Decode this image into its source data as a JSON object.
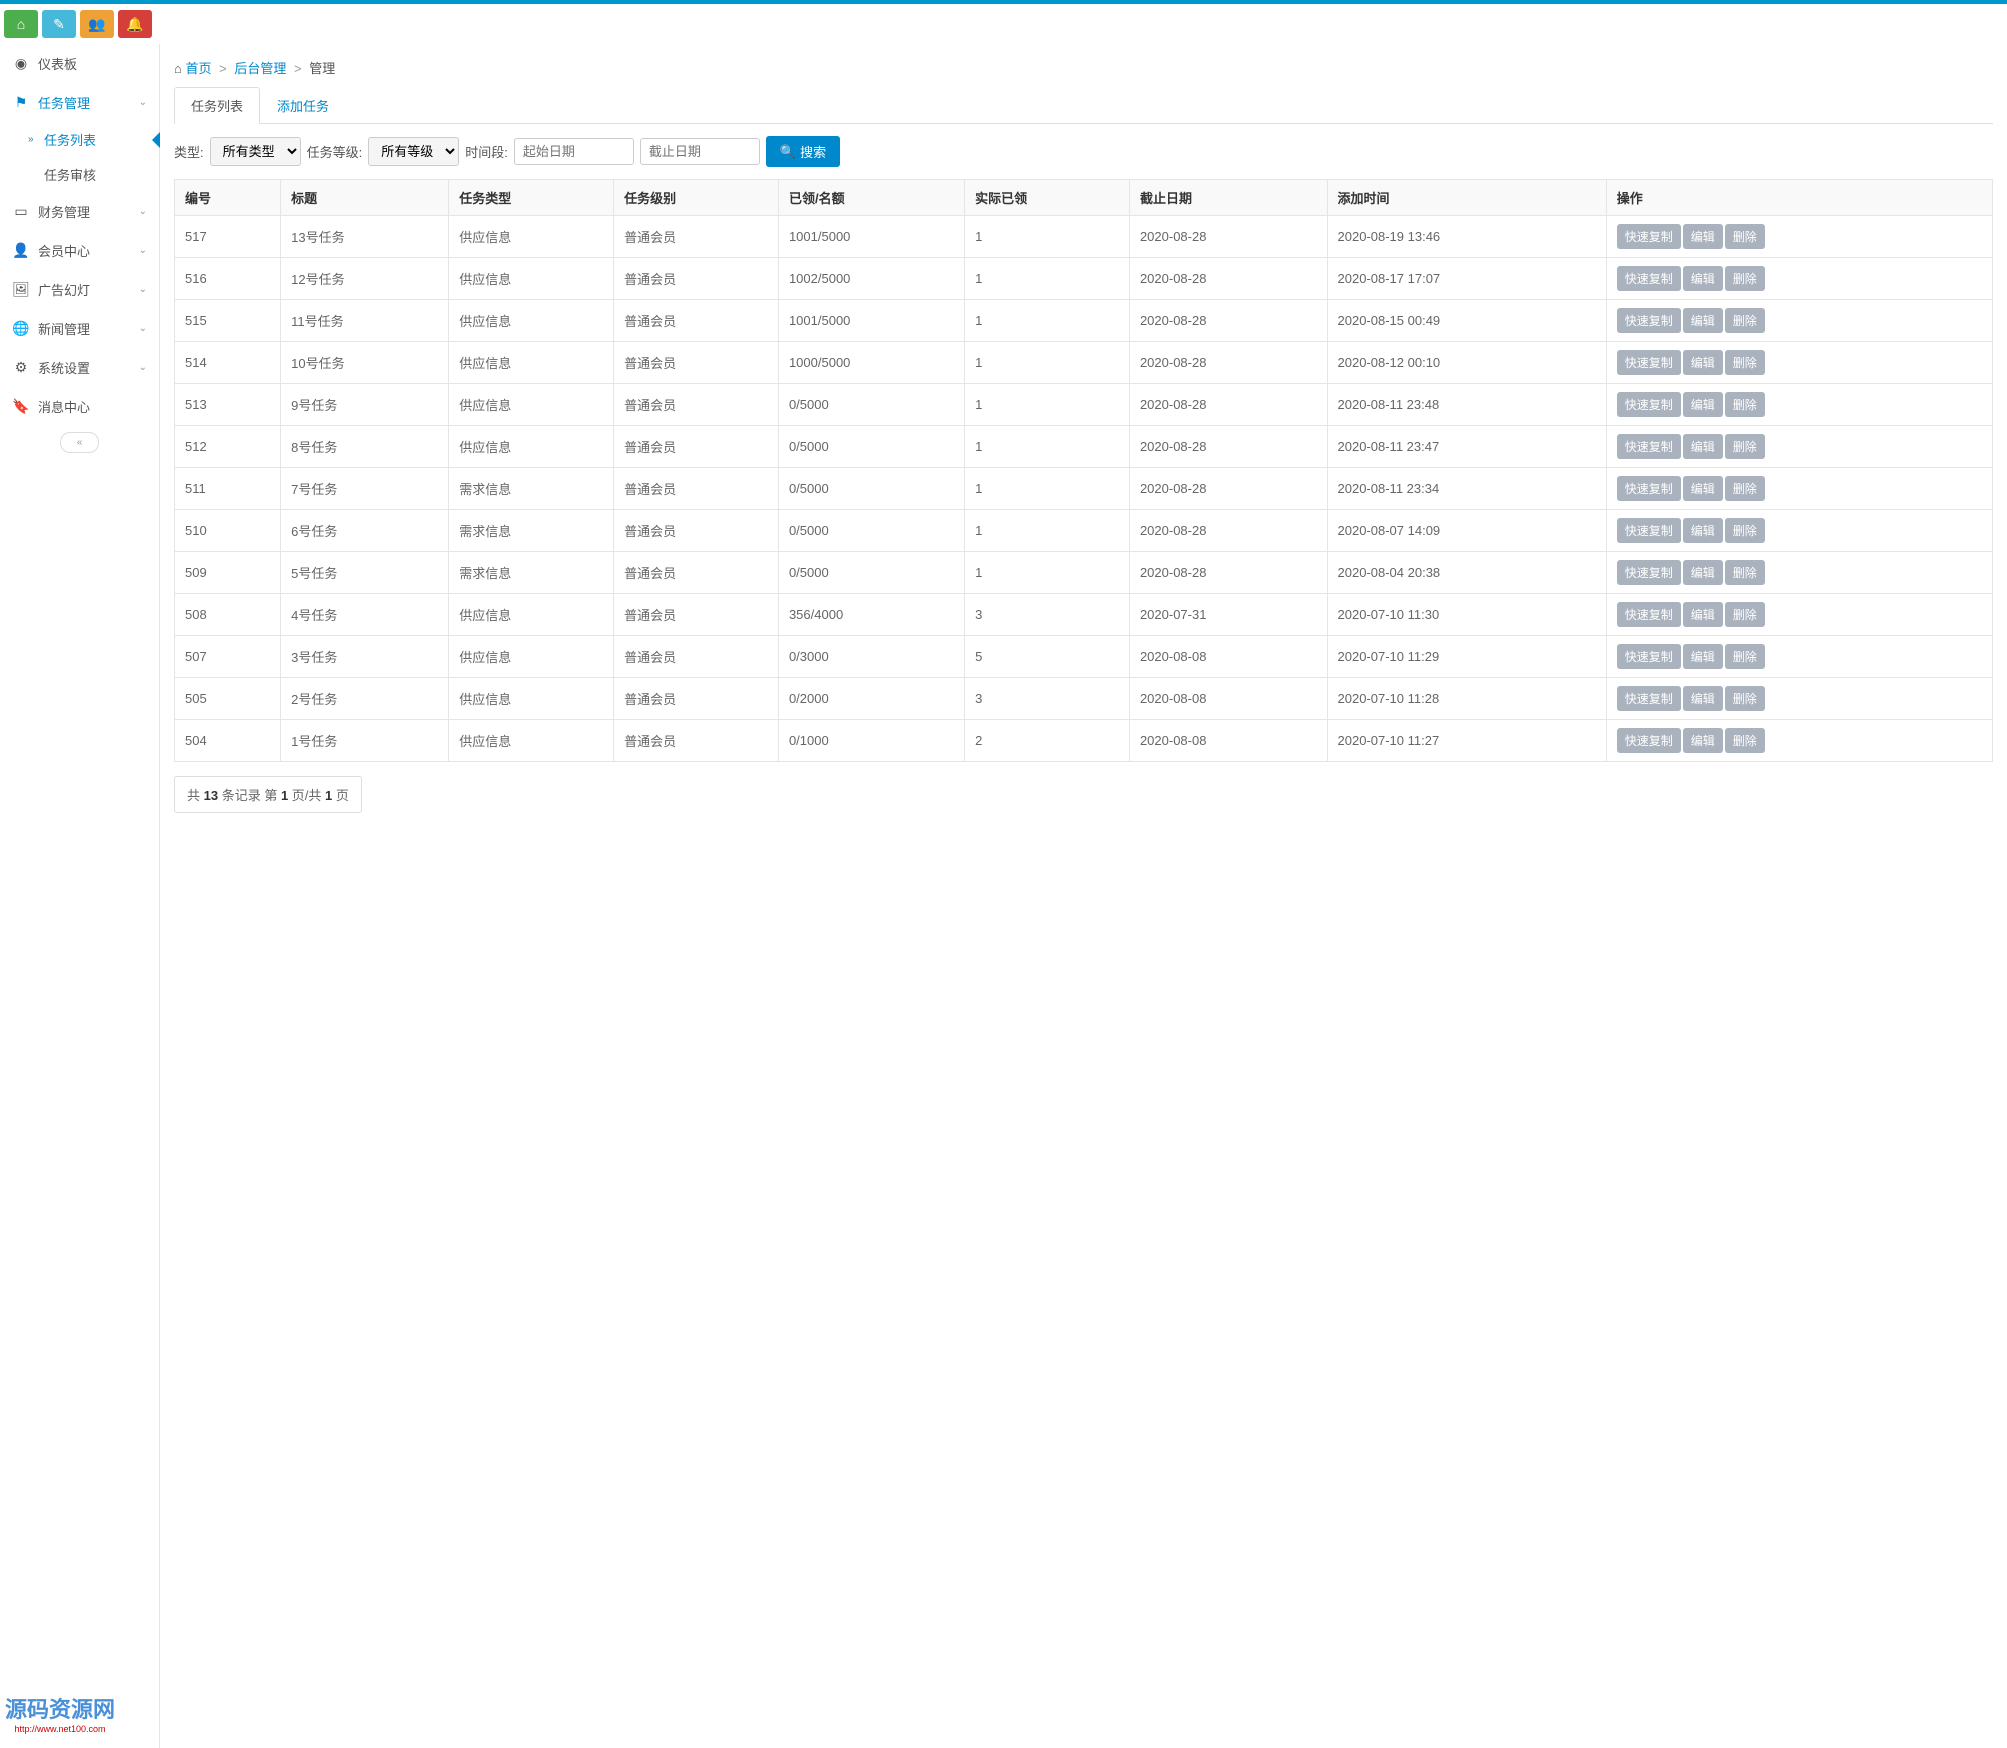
{
  "toolbar_icons": [
    "home",
    "pencil",
    "group",
    "bell"
  ],
  "breadcrumb": {
    "home_icon": "home",
    "home": "首页",
    "mid": "后台管理",
    "current": "管理"
  },
  "sidebar": {
    "items": [
      {
        "icon": "dashboard",
        "label": "仪表板",
        "expand": false
      },
      {
        "icon": "flag",
        "label": "任务管理",
        "expand": true,
        "active": true,
        "children": [
          {
            "label": "任务列表",
            "active": true
          },
          {
            "label": "任务审核",
            "active": false
          }
        ]
      },
      {
        "icon": "credit",
        "label": "财务管理",
        "expand": true
      },
      {
        "icon": "user",
        "label": "会员中心",
        "expand": true
      },
      {
        "icon": "image",
        "label": "广告幻灯",
        "expand": true
      },
      {
        "icon": "globe",
        "label": "新闻管理",
        "expand": true
      },
      {
        "icon": "gear",
        "label": "系统设置",
        "expand": true
      },
      {
        "icon": "bookmark",
        "label": "消息中心",
        "expand": false
      }
    ]
  },
  "tabs": [
    {
      "label": "任务列表",
      "active": true
    },
    {
      "label": "添加任务",
      "active": false
    }
  ],
  "filters": {
    "type_label": "类型:",
    "type_value": "所有类型",
    "level_label": "任务等级:",
    "level_value": "所有等级",
    "time_label": "时间段:",
    "start_placeholder": "起始日期",
    "end_placeholder": "截止日期",
    "search_label": "搜索"
  },
  "columns": [
    "编号",
    "标题",
    "任务类型",
    "任务级别",
    "已领/名额",
    "实际已领",
    "截止日期",
    "添加时间",
    "操作"
  ],
  "actions": {
    "copy": "快速复制",
    "edit": "编辑",
    "delete": "删除"
  },
  "rows": [
    {
      "id": "517",
      "title": "13号任务",
      "type": "供应信息",
      "level": "普通会员",
      "quota": "1001/5000",
      "taken": "1",
      "deadline": "2020-08-28",
      "added": "2020-08-19 13:46"
    },
    {
      "id": "516",
      "title": "12号任务",
      "type": "供应信息",
      "level": "普通会员",
      "quota": "1002/5000",
      "taken": "1",
      "deadline": "2020-08-28",
      "added": "2020-08-17 17:07"
    },
    {
      "id": "515",
      "title": "11号任务",
      "type": "供应信息",
      "level": "普通会员",
      "quota": "1001/5000",
      "taken": "1",
      "deadline": "2020-08-28",
      "added": "2020-08-15 00:49"
    },
    {
      "id": "514",
      "title": "10号任务",
      "type": "供应信息",
      "level": "普通会员",
      "quota": "1000/5000",
      "taken": "1",
      "deadline": "2020-08-28",
      "added": "2020-08-12 00:10"
    },
    {
      "id": "513",
      "title": "9号任务",
      "type": "供应信息",
      "level": "普通会员",
      "quota": "0/5000",
      "taken": "1",
      "deadline": "2020-08-28",
      "added": "2020-08-11 23:48"
    },
    {
      "id": "512",
      "title": "8号任务",
      "type": "供应信息",
      "level": "普通会员",
      "quota": "0/5000",
      "taken": "1",
      "deadline": "2020-08-28",
      "added": "2020-08-11 23:47"
    },
    {
      "id": "511",
      "title": "7号任务",
      "type": "需求信息",
      "level": "普通会员",
      "quota": "0/5000",
      "taken": "1",
      "deadline": "2020-08-28",
      "added": "2020-08-11 23:34"
    },
    {
      "id": "510",
      "title": "6号任务",
      "type": "需求信息",
      "level": "普通会员",
      "quota": "0/5000",
      "taken": "1",
      "deadline": "2020-08-28",
      "added": "2020-08-07 14:09"
    },
    {
      "id": "509",
      "title": "5号任务",
      "type": "需求信息",
      "level": "普通会员",
      "quota": "0/5000",
      "taken": "1",
      "deadline": "2020-08-28",
      "added": "2020-08-04 20:38"
    },
    {
      "id": "508",
      "title": "4号任务",
      "type": "供应信息",
      "level": "普通会员",
      "quota": "356/4000",
      "taken": "3",
      "deadline": "2020-07-31",
      "added": "2020-07-10 11:30"
    },
    {
      "id": "507",
      "title": "3号任务",
      "type": "供应信息",
      "level": "普通会员",
      "quota": "0/3000",
      "taken": "5",
      "deadline": "2020-08-08",
      "added": "2020-07-10 11:29"
    },
    {
      "id": "505",
      "title": "2号任务",
      "type": "供应信息",
      "level": "普通会员",
      "quota": "0/2000",
      "taken": "3",
      "deadline": "2020-08-08",
      "added": "2020-07-10 11:28"
    },
    {
      "id": "504",
      "title": "1号任务",
      "type": "供应信息",
      "level": "普通会员",
      "quota": "0/1000",
      "taken": "2",
      "deadline": "2020-08-08",
      "added": "2020-07-10 11:27"
    }
  ],
  "pager": {
    "prefix": "共 ",
    "total": "13",
    "mid": " 条记录 第 ",
    "page": "1",
    "mid2": " 页/共 ",
    "pages": "1",
    "suffix": " 页"
  },
  "watermark": {
    "main": "源码资源网",
    "sub": "http://www.net100.com"
  }
}
